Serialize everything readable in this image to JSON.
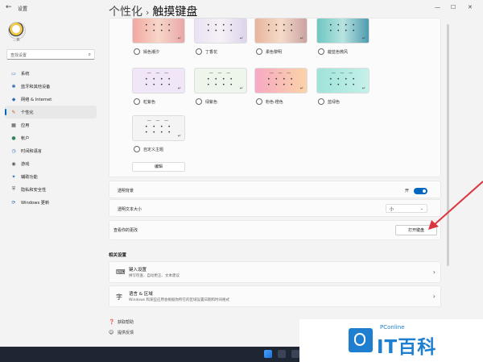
{
  "window": {
    "title": "设置",
    "back_icon": "←",
    "controls": [
      "—",
      "☐",
      "✕"
    ]
  },
  "sidebar": {
    "avatar_sub": "…R",
    "search_placeholder": "查找设置",
    "items": [
      {
        "label": "系统",
        "icon": "system-icon",
        "glyph": "▭",
        "color": "#2b6cb0"
      },
      {
        "label": "蓝牙和其他设备",
        "icon": "bluetooth-icon",
        "glyph": "✱",
        "color": "#2b6cb0"
      },
      {
        "label": "网络 & Internet",
        "icon": "network-icon",
        "glyph": "◆",
        "color": "#2b6cb0"
      },
      {
        "label": "个性化",
        "icon": "brush-icon",
        "glyph": "✎",
        "color": "#c05621",
        "active": true
      },
      {
        "label": "应用",
        "icon": "apps-icon",
        "glyph": "▦",
        "color": "#444"
      },
      {
        "label": "帐户",
        "icon": "account-icon",
        "glyph": "●",
        "color": "#2f855a"
      },
      {
        "label": "时间和语言",
        "icon": "time-language-icon",
        "glyph": "◷",
        "color": "#2b6cb0"
      },
      {
        "label": "游戏",
        "icon": "gaming-icon",
        "glyph": "◉",
        "color": "#555"
      },
      {
        "label": "辅助功能",
        "icon": "accessibility-icon",
        "glyph": "✦",
        "color": "#2b6cb0"
      },
      {
        "label": "隐私和安全性",
        "icon": "shield-icon",
        "glyph": "⛨",
        "color": "#555"
      },
      {
        "label": "Windows 更新",
        "icon": "update-icon",
        "glyph": "⟳",
        "color": "#2b6cb0"
      }
    ]
  },
  "header": {
    "parent": "个性化",
    "separator": "›",
    "title": "触摸键盘"
  },
  "themes": {
    "row1": [
      {
        "label": "嫣色潮汐",
        "bg": "linear-gradient(90deg,#f2a7a0,#f7d6c9,#e9a7a7)"
      },
      {
        "label": "丁香花",
        "bg": "linear-gradient(90deg,#e9e1f2,#f6f1f7,#ddd3ec)"
      },
      {
        "label": "柔色黎明",
        "bg": "linear-gradient(90deg,#e8b49c,#f5dbc8,#caa2a2)"
      },
      {
        "label": "靛蓝色微风",
        "bg": "linear-gradient(90deg,#6ec7c2,#b7e3df,#4f9bb0)"
      }
    ],
    "row2": [
      {
        "label": "粒紫色",
        "bg": "#f0e6f8"
      },
      {
        "label": "绿紫色",
        "bg": "#eef6ec"
      },
      {
        "label": "粉色-橙色",
        "bg": "linear-gradient(90deg,#f7a9c4,#fbd3a8)"
      },
      {
        "label": "蓝绿色",
        "bg": "linear-gradient(90deg,#9fe3d8,#c5f1e9)"
      }
    ],
    "custom": {
      "label": "自定义主题",
      "bg": "#f4f4f4"
    },
    "edit_button": "编辑",
    "dots_glyph": "• • • •",
    "bars_glyph": "— — —",
    "enter_glyph": "↵"
  },
  "settings": {
    "transparent_bg_label": "透明背景",
    "toggle_state": "开",
    "text_size_label": "透明文本大小",
    "text_size_value": "小",
    "view_changes_label": "查看你的更改",
    "open_keyboard_button": "打开键盘"
  },
  "related": {
    "title": "相关设置",
    "items": [
      {
        "title": "键入设置",
        "desc": "拼写检查、自动更正、文本建议",
        "icon": "keyboard-icon",
        "glyph": "⌨"
      },
      {
        "title": "语言 & 区域",
        "desc": "Windows 和某些应用会根据你所在的区域设置日期和时间格式",
        "icon": "language-icon",
        "glyph": "字"
      }
    ],
    "chevron": "›"
  },
  "help": {
    "get_help": "获取帮助",
    "feedback": "提供反馈"
  },
  "watermark": {
    "brand_small": "PConline",
    "brand_big": "IT百科"
  },
  "colors": {
    "accent": "#0067c0",
    "annotation_arrow": "#d9363e",
    "taskbar": "#1e2533"
  }
}
